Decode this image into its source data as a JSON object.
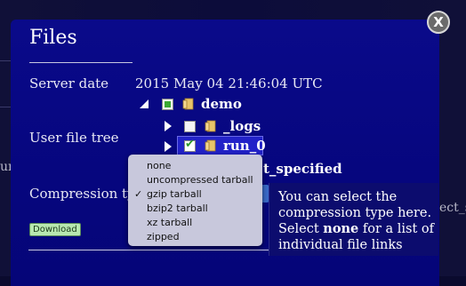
{
  "dialog": {
    "title": "Files",
    "close_label": "X"
  },
  "server_date": {
    "label": "Server date",
    "value": "2015 May 04 21:46:04 UTC"
  },
  "file_tree": {
    "label": "User file tree",
    "nodes": [
      {
        "name": "demo",
        "expanded": true,
        "checkbox": "partial"
      },
      {
        "name": "_logs",
        "expanded": false,
        "checkbox": "unchecked"
      },
      {
        "name": "run_0",
        "expanded": false,
        "checkbox": "checked",
        "selected": true
      },
      {
        "name": "t_specified"
      }
    ]
  },
  "compression": {
    "label": "Compression type",
    "selected": "gzip tarball",
    "options": [
      "none",
      "uncompressed tarball",
      "gzip tarball",
      "bzip2 tarball",
      "xz tarball",
      "zipped"
    ]
  },
  "download_label": "Download",
  "tooltip": {
    "line1": "You can select the",
    "line2": "compression type here.",
    "pre": "Select ",
    "bold": "none",
    "post": " for a list of",
    "line4": "individual file links"
  },
  "background": {
    "fragment_left": "un",
    "fragment_right": "ect_s"
  },
  "colors": {
    "dialog_bg": "#0a0a8a",
    "selection": "#2222c8",
    "checkbox_green": "#3aa832",
    "download_bg": "#b8e8b0"
  }
}
